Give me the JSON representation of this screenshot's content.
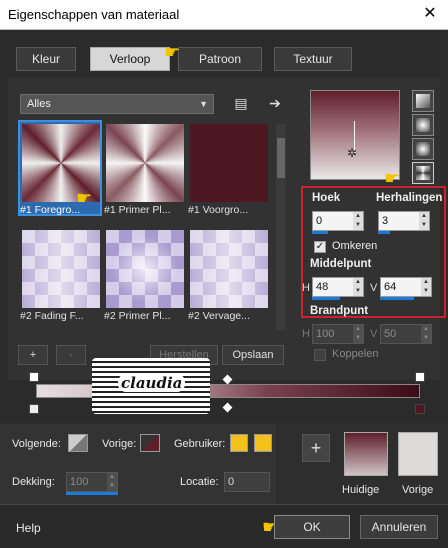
{
  "window": {
    "title": "Eigenschappen van materiaal",
    "close_glyph": "✕"
  },
  "tabs": [
    {
      "label": "Kleur",
      "active": false
    },
    {
      "label": "Verloop",
      "active": true
    },
    {
      "label": "Patroon",
      "active": false
    },
    {
      "label": "Textuur",
      "active": false
    }
  ],
  "library": {
    "category": "Alles",
    "thumbnails": [
      {
        "caption": "#1 Foregro...",
        "selected": true,
        "icon": "pointing-hand-icon"
      },
      {
        "caption": "#1 Primer Pl...",
        "selected": false
      },
      {
        "caption": "#1 Voorgro...",
        "selected": false
      },
      {
        "caption": "#2 Fading F...",
        "selected": false
      },
      {
        "caption": "#2 Primer Pl...",
        "selected": false
      },
      {
        "caption": "#2 Vervage...",
        "selected": false
      }
    ],
    "add_label": "+",
    "remove_label": "-",
    "reset_label": "Herstellen",
    "save_label": "Opslaan"
  },
  "properties": {
    "hoek_label": "Hoek",
    "hoek_value": "0",
    "herhalingen_label": "Herhalingen",
    "herhalingen_value": "3",
    "omkeren_label": "Omkeren",
    "omkeren_checked": true,
    "middelpunt_label": "Middelpunt",
    "middel_h_label": "H",
    "middel_h_value": "48",
    "middel_v_label": "V",
    "middel_v_value": "64",
    "brandpunt_label": "Brandpunt",
    "brand_h_label": "H",
    "brand_h_value": "100",
    "brand_v_label": "V",
    "brand_v_value": "50",
    "koppelen_label": "Koppelen",
    "koppelen_checked": false
  },
  "editor": {
    "watermark_text": "claudia"
  },
  "colors": {
    "volgende_label": "Volgende:",
    "vorige_label": "Vorige:",
    "gebruiker_label": "Gebruiker:",
    "dekking_label": "Dekking:",
    "dekking_value": "100",
    "locatie_label": "Locatie:",
    "locatie_value": "0",
    "add_label": "+",
    "huidige_label": "Huidige",
    "vorige_swatch_label": "Vorige",
    "vorige_color": "#5e1f2b",
    "gebruiker_colors": [
      "#f2c21a",
      "#f2c21a"
    ]
  },
  "footer": {
    "help_label": "Help",
    "ok_label": "OK",
    "cancel_label": "Annuleren"
  },
  "accent": "#1e7ad8",
  "highlight_box": "#d0202a"
}
